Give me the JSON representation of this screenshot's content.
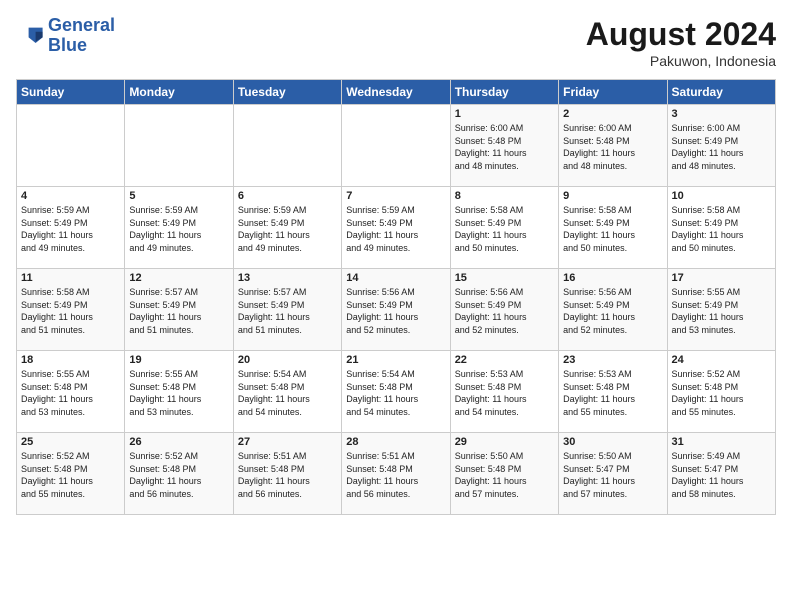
{
  "logo": {
    "line1": "General",
    "line2": "Blue"
  },
  "title": "August 2024",
  "location": "Pakuwon, Indonesia",
  "weekdays": [
    "Sunday",
    "Monday",
    "Tuesday",
    "Wednesday",
    "Thursday",
    "Friday",
    "Saturday"
  ],
  "weeks": [
    [
      {
        "day": "",
        "info": ""
      },
      {
        "day": "",
        "info": ""
      },
      {
        "day": "",
        "info": ""
      },
      {
        "day": "",
        "info": ""
      },
      {
        "day": "1",
        "info": "Sunrise: 6:00 AM\nSunset: 5:48 PM\nDaylight: 11 hours\nand 48 minutes."
      },
      {
        "day": "2",
        "info": "Sunrise: 6:00 AM\nSunset: 5:48 PM\nDaylight: 11 hours\nand 48 minutes."
      },
      {
        "day": "3",
        "info": "Sunrise: 6:00 AM\nSunset: 5:49 PM\nDaylight: 11 hours\nand 48 minutes."
      }
    ],
    [
      {
        "day": "4",
        "info": "Sunrise: 5:59 AM\nSunset: 5:49 PM\nDaylight: 11 hours\nand 49 minutes."
      },
      {
        "day": "5",
        "info": "Sunrise: 5:59 AM\nSunset: 5:49 PM\nDaylight: 11 hours\nand 49 minutes."
      },
      {
        "day": "6",
        "info": "Sunrise: 5:59 AM\nSunset: 5:49 PM\nDaylight: 11 hours\nand 49 minutes."
      },
      {
        "day": "7",
        "info": "Sunrise: 5:59 AM\nSunset: 5:49 PM\nDaylight: 11 hours\nand 49 minutes."
      },
      {
        "day": "8",
        "info": "Sunrise: 5:58 AM\nSunset: 5:49 PM\nDaylight: 11 hours\nand 50 minutes."
      },
      {
        "day": "9",
        "info": "Sunrise: 5:58 AM\nSunset: 5:49 PM\nDaylight: 11 hours\nand 50 minutes."
      },
      {
        "day": "10",
        "info": "Sunrise: 5:58 AM\nSunset: 5:49 PM\nDaylight: 11 hours\nand 50 minutes."
      }
    ],
    [
      {
        "day": "11",
        "info": "Sunrise: 5:58 AM\nSunset: 5:49 PM\nDaylight: 11 hours\nand 51 minutes."
      },
      {
        "day": "12",
        "info": "Sunrise: 5:57 AM\nSunset: 5:49 PM\nDaylight: 11 hours\nand 51 minutes."
      },
      {
        "day": "13",
        "info": "Sunrise: 5:57 AM\nSunset: 5:49 PM\nDaylight: 11 hours\nand 51 minutes."
      },
      {
        "day": "14",
        "info": "Sunrise: 5:56 AM\nSunset: 5:49 PM\nDaylight: 11 hours\nand 52 minutes."
      },
      {
        "day": "15",
        "info": "Sunrise: 5:56 AM\nSunset: 5:49 PM\nDaylight: 11 hours\nand 52 minutes."
      },
      {
        "day": "16",
        "info": "Sunrise: 5:56 AM\nSunset: 5:49 PM\nDaylight: 11 hours\nand 52 minutes."
      },
      {
        "day": "17",
        "info": "Sunrise: 5:55 AM\nSunset: 5:49 PM\nDaylight: 11 hours\nand 53 minutes."
      }
    ],
    [
      {
        "day": "18",
        "info": "Sunrise: 5:55 AM\nSunset: 5:48 PM\nDaylight: 11 hours\nand 53 minutes."
      },
      {
        "day": "19",
        "info": "Sunrise: 5:55 AM\nSunset: 5:48 PM\nDaylight: 11 hours\nand 53 minutes."
      },
      {
        "day": "20",
        "info": "Sunrise: 5:54 AM\nSunset: 5:48 PM\nDaylight: 11 hours\nand 54 minutes."
      },
      {
        "day": "21",
        "info": "Sunrise: 5:54 AM\nSunset: 5:48 PM\nDaylight: 11 hours\nand 54 minutes."
      },
      {
        "day": "22",
        "info": "Sunrise: 5:53 AM\nSunset: 5:48 PM\nDaylight: 11 hours\nand 54 minutes."
      },
      {
        "day": "23",
        "info": "Sunrise: 5:53 AM\nSunset: 5:48 PM\nDaylight: 11 hours\nand 55 minutes."
      },
      {
        "day": "24",
        "info": "Sunrise: 5:52 AM\nSunset: 5:48 PM\nDaylight: 11 hours\nand 55 minutes."
      }
    ],
    [
      {
        "day": "25",
        "info": "Sunrise: 5:52 AM\nSunset: 5:48 PM\nDaylight: 11 hours\nand 55 minutes."
      },
      {
        "day": "26",
        "info": "Sunrise: 5:52 AM\nSunset: 5:48 PM\nDaylight: 11 hours\nand 56 minutes."
      },
      {
        "day": "27",
        "info": "Sunrise: 5:51 AM\nSunset: 5:48 PM\nDaylight: 11 hours\nand 56 minutes."
      },
      {
        "day": "28",
        "info": "Sunrise: 5:51 AM\nSunset: 5:48 PM\nDaylight: 11 hours\nand 56 minutes."
      },
      {
        "day": "29",
        "info": "Sunrise: 5:50 AM\nSunset: 5:48 PM\nDaylight: 11 hours\nand 57 minutes."
      },
      {
        "day": "30",
        "info": "Sunrise: 5:50 AM\nSunset: 5:47 PM\nDaylight: 11 hours\nand 57 minutes."
      },
      {
        "day": "31",
        "info": "Sunrise: 5:49 AM\nSunset: 5:47 PM\nDaylight: 11 hours\nand 58 minutes."
      }
    ]
  ]
}
